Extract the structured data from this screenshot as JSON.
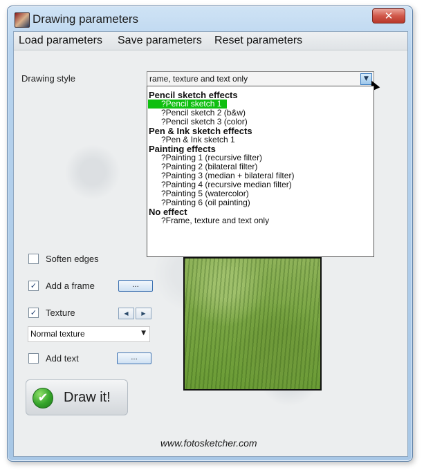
{
  "window": {
    "title": "Drawing parameters",
    "close_glyph": "✕"
  },
  "menu": [
    "Load parameters",
    "Save parameters",
    "Reset parameters"
  ],
  "drawing_style": {
    "label": "Drawing style",
    "selected": "rame, texture and text only",
    "options": [
      {
        "type": "group",
        "label": "Pencil sketch effects"
      },
      {
        "type": "item",
        "label": "?Pencil sketch 1",
        "selected": true
      },
      {
        "type": "item",
        "label": "?Pencil sketch 2 (b&w)"
      },
      {
        "type": "item",
        "label": "?Pencil sketch 3 (color)"
      },
      {
        "type": "group",
        "label": "Pen & Ink sketch effects"
      },
      {
        "type": "item",
        "label": "?Pen & Ink sketch 1"
      },
      {
        "type": "group",
        "label": "Painting effects"
      },
      {
        "type": "item",
        "label": "?Painting 1 (recursive filter)"
      },
      {
        "type": "item",
        "label": "?Painting 2 (bilateral filter)"
      },
      {
        "type": "item",
        "label": "?Painting 3 (median + bilateral filter)"
      },
      {
        "type": "item",
        "label": "?Painting 4 (recursive median filter)"
      },
      {
        "type": "item",
        "label": "?Painting 5 (watercolor)"
      },
      {
        "type": "item",
        "label": "?Painting 6 (oil painting)"
      },
      {
        "type": "group",
        "label": "No effect"
      },
      {
        "type": "item",
        "label": "?Frame, texture and text only"
      }
    ]
  },
  "options": {
    "soften_edges": {
      "label": "Soften edges",
      "checked": false
    },
    "add_frame": {
      "label": "Add a frame",
      "checked": true,
      "button": "..."
    },
    "texture": {
      "label": "Texture",
      "checked": true,
      "prev": "◀",
      "next": "▶",
      "selected": "Normal texture"
    },
    "add_text": {
      "label": "Add text",
      "checked": false,
      "button": "..."
    }
  },
  "draw_button": {
    "label": "Draw it!",
    "icon_glyph": "✔"
  },
  "footer": "www.fotosketcher.com",
  "colors": {
    "selection": "#0fbf10",
    "accent_blue": "#3a7bbf"
  }
}
